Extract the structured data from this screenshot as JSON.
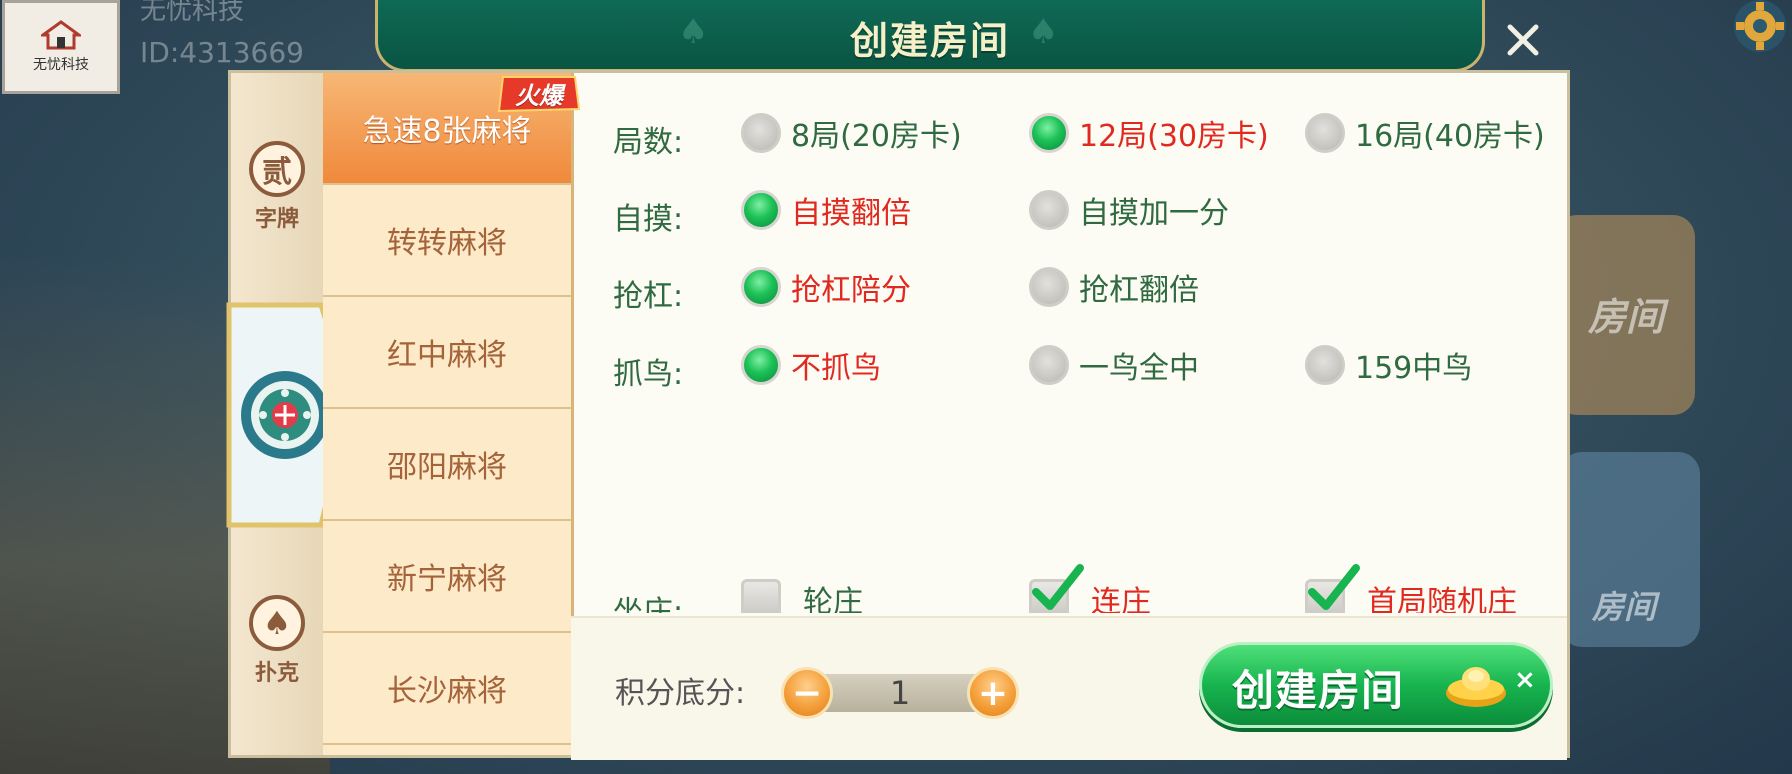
{
  "account": {
    "logo_text": "无忧科技",
    "name": "无忧科技",
    "id_text": "ID:4313669"
  },
  "background": {
    "card_upper_text": "房间",
    "card_lower_text": "房间"
  },
  "dialog": {
    "title": "创建房间",
    "close_symbol": "✕"
  },
  "categories": [
    {
      "label": "字牌",
      "glyph": "贰"
    },
    {
      "label": "麻将",
      "glyph": ""
    },
    {
      "label": "扑克",
      "glyph": "♠"
    }
  ],
  "games": {
    "hot_badge": "火爆",
    "items": [
      {
        "label": "急速8张麻将",
        "active": true
      },
      {
        "label": "转转麻将",
        "active": false
      },
      {
        "label": "红中麻将",
        "active": false
      },
      {
        "label": "邵阳麻将",
        "active": false
      },
      {
        "label": "新宁麻将",
        "active": false
      },
      {
        "label": "长沙麻将",
        "active": false
      }
    ]
  },
  "options": {
    "rounds": {
      "label": "局数:",
      "choices": [
        {
          "text": "8局(20房卡)",
          "selected": false
        },
        {
          "text": "12局(30房卡)",
          "selected": true
        },
        {
          "text": "16局(40房卡)",
          "selected": false
        }
      ]
    },
    "self_draw": {
      "label": "自摸:",
      "choices": [
        {
          "text": "自摸翻倍",
          "selected": true
        },
        {
          "text": "自摸加一分",
          "selected": false
        }
      ]
    },
    "rob_kong": {
      "label": "抢杠:",
      "choices": [
        {
          "text": "抢杠陪分",
          "selected": true
        },
        {
          "text": "抢杠翻倍",
          "selected": false
        }
      ]
    },
    "catch_bird": {
      "label": "抓鸟:",
      "choices": [
        {
          "text": "不抓鸟",
          "selected": true
        },
        {
          "text": "一鸟全中",
          "selected": false
        },
        {
          "text": "159中鸟",
          "selected": false
        }
      ]
    },
    "dealer": {
      "label": "坐庄:",
      "choices": [
        {
          "text": "轮庄",
          "checked": false
        },
        {
          "text": "连庄",
          "checked": true
        },
        {
          "text": "首局随机庄",
          "checked": true
        }
      ]
    }
  },
  "footer": {
    "score_label": "积分底分:",
    "minus": "−",
    "plus": "+",
    "score_value": "1",
    "create_label": "创建房间",
    "times_symbol": "×"
  },
  "colors": {
    "header_green": "#0f6a55",
    "selected_red": "#e02a20",
    "option_green": "#2f6a40",
    "tab_orange": "#f0893b",
    "button_green": "#17b44f"
  }
}
